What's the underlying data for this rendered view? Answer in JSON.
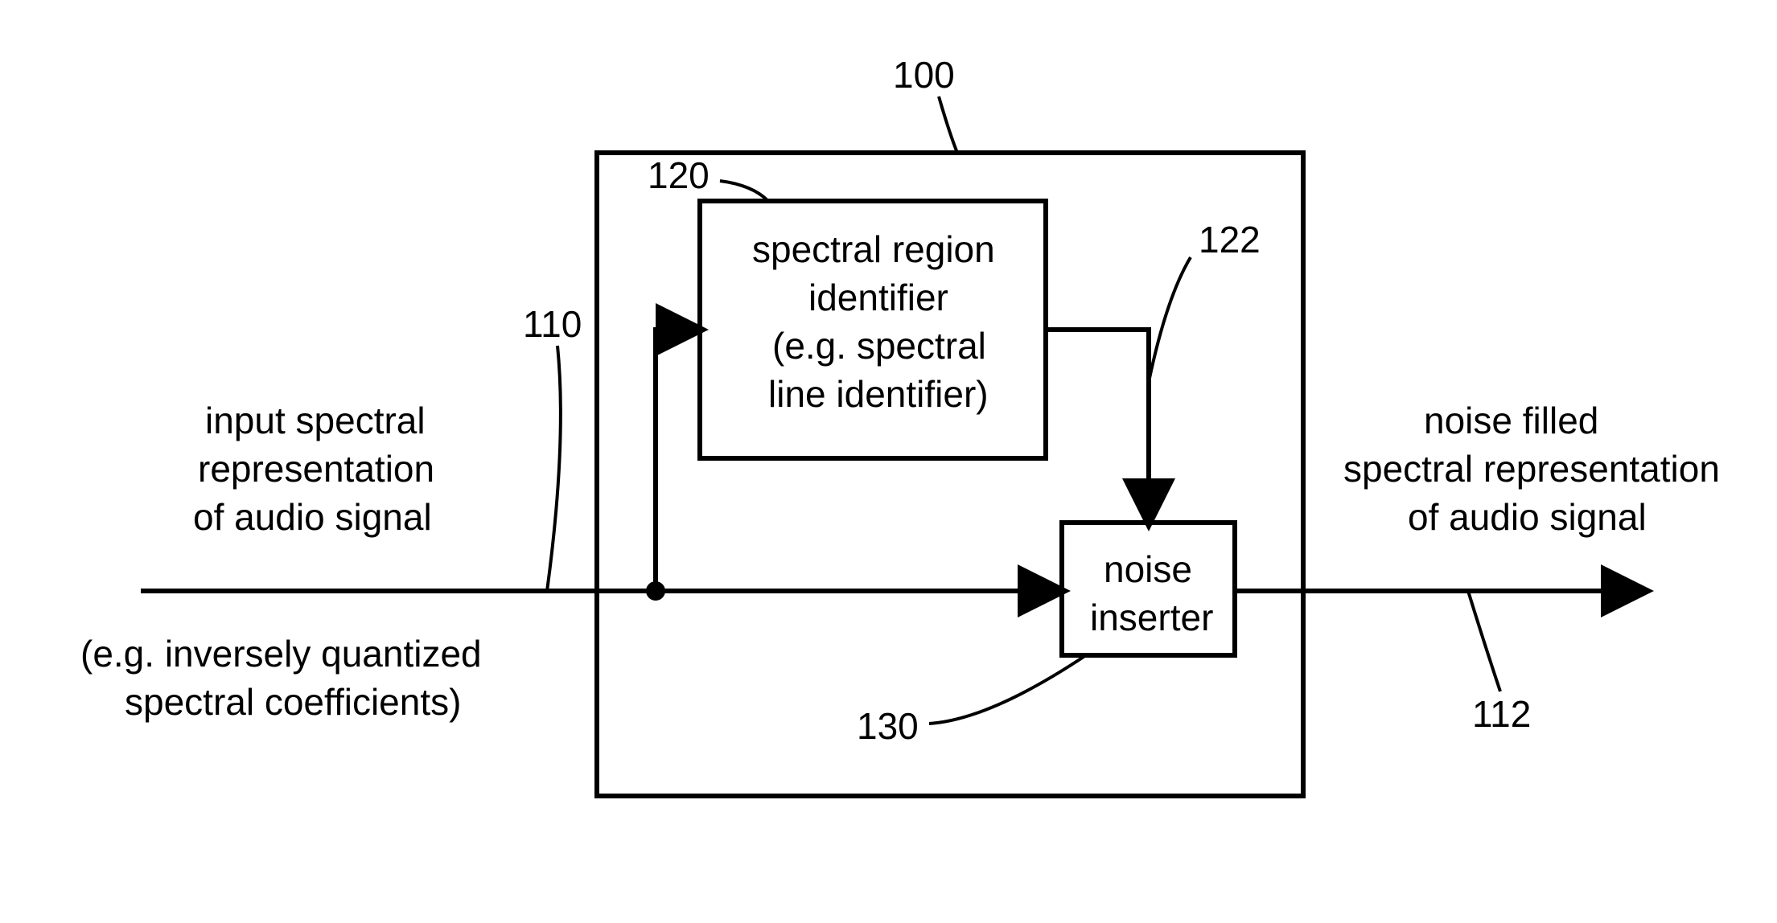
{
  "labels": {
    "ref_outer": "100",
    "ref_input": "110",
    "ref_sri": "120",
    "ref_link": "122",
    "ref_ni": "130",
    "ref_output": "112",
    "input_l1": "input spectral",
    "input_l2": "representation",
    "input_l3": "of audio signal",
    "input_sub_l1": "(e.g. inversely quantized",
    "input_sub_l2": "spectral coefficients)",
    "sri_l1": "spectral region",
    "sri_l2": "identifier",
    "sri_l3": "(e.g. spectral",
    "sri_l4": "line identifier)",
    "ni_l1": "noise",
    "ni_l2": "inserter",
    "output_l1": "noise filled",
    "output_l2": "spectral representation",
    "output_l3": "of audio signal"
  }
}
